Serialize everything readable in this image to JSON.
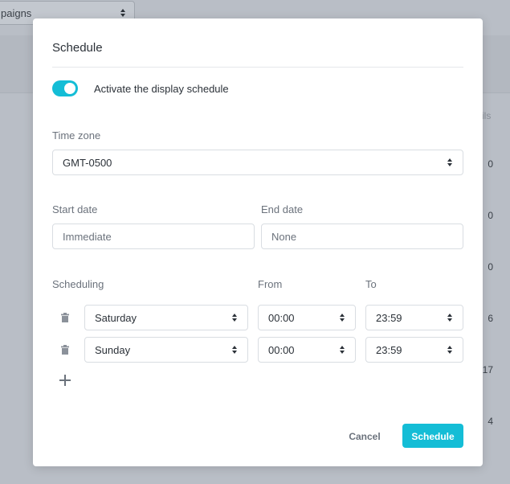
{
  "background": {
    "campaign_select": {
      "value": "paigns"
    },
    "column_header": "ils",
    "column_values": [
      "0",
      "0",
      "0",
      "6",
      "17",
      "4"
    ]
  },
  "modal": {
    "title": "Schedule",
    "toggle": {
      "label": "Activate the display schedule",
      "on": true
    },
    "timezone": {
      "label": "Time zone",
      "value": "GMT-0500"
    },
    "start_date": {
      "label": "Start date",
      "placeholder": "Immediate"
    },
    "end_date": {
      "label": "End date",
      "placeholder": "None"
    },
    "scheduling": {
      "headers": {
        "day": "Scheduling",
        "from": "From",
        "to": "To"
      },
      "rows": [
        {
          "day": "Saturday",
          "from": "00:00",
          "to": "23:59"
        },
        {
          "day": "Sunday",
          "from": "00:00",
          "to": "23:59"
        }
      ]
    },
    "buttons": {
      "cancel": "Cancel",
      "submit": "Schedule"
    }
  },
  "colors": {
    "accent": "#14bdd6",
    "overlay": "#b9bec6",
    "text": "#2b3138",
    "muted": "#6b727c"
  }
}
